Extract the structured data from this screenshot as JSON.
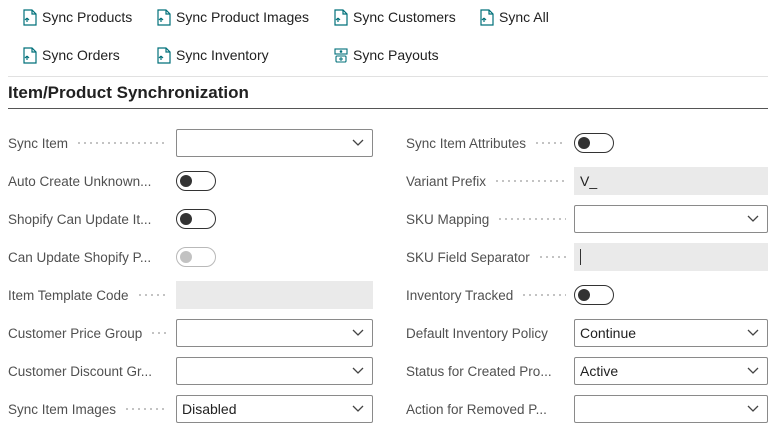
{
  "actions": {
    "sync_products": "Sync Products",
    "sync_product_images": "Sync Product Images",
    "sync_customers": "Sync Customers",
    "sync_all": "Sync All",
    "sync_orders": "Sync Orders",
    "sync_inventory": "Sync Inventory",
    "sync_payouts": "Sync Payouts"
  },
  "section": {
    "title": "Item/Product Synchronization"
  },
  "fields": {
    "sync_item": {
      "label": "Sync Item",
      "value": ""
    },
    "auto_create_unknown": {
      "label": "Auto Create Unknown...",
      "on": false
    },
    "shopify_can_update": {
      "label": "Shopify Can Update It...",
      "on": false
    },
    "can_update_shopify": {
      "label": "Can Update Shopify P...",
      "on": false,
      "disabled": true
    },
    "item_template_code": {
      "label": "Item Template Code",
      "value": ""
    },
    "customer_price_group": {
      "label": "Customer Price Group",
      "value": ""
    },
    "customer_discount_group": {
      "label": "Customer Discount Gr...",
      "value": ""
    },
    "sync_item_images": {
      "label": "Sync Item Images",
      "value": "Disabled"
    },
    "sync_item_attributes": {
      "label": "Sync Item Attributes",
      "on": false
    },
    "variant_prefix": {
      "label": "Variant Prefix",
      "value": "V_"
    },
    "sku_mapping": {
      "label": "SKU Mapping",
      "value": ""
    },
    "sku_field_separator": {
      "label": "SKU Field Separator",
      "value": ""
    },
    "inventory_tracked": {
      "label": "Inventory Tracked",
      "on": false
    },
    "default_inventory_policy": {
      "label": "Default Inventory Policy",
      "value": "Continue"
    },
    "status_for_created_products": {
      "label": "Status for Created Pro...",
      "value": "Active"
    },
    "action_for_removed_products": {
      "label": "Action for Removed P...",
      "value": ""
    }
  },
  "icons": {
    "document_sync": "document-sync-icon",
    "payouts": "payouts-icon",
    "dropdown": "chevron-down-icon"
  },
  "colors": {
    "accent": "#00707a",
    "toggle_on_dark": "#333333",
    "readonly_bg": "#eaeaea"
  }
}
